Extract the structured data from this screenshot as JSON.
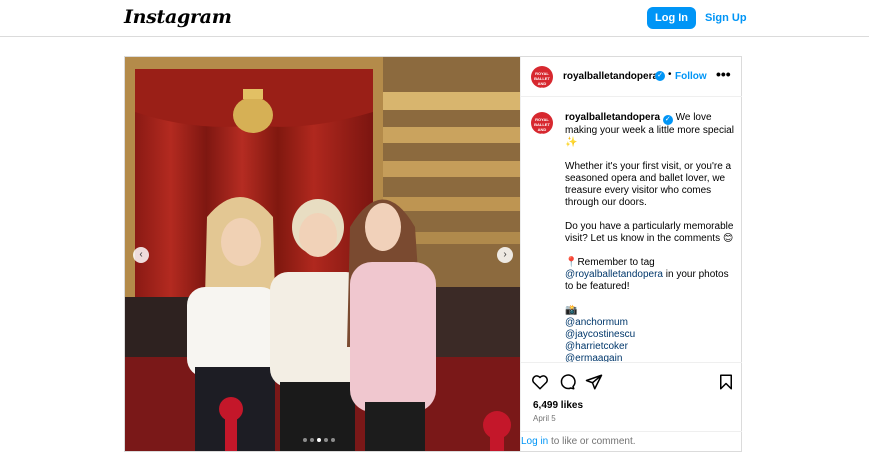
{
  "header": {
    "logo": "Instagram",
    "login_label": "Log In",
    "signup_label": "Sign Up"
  },
  "post": {
    "username": "royalballetandopera",
    "avatar_text": "ROYAL BALLET AND OPERA",
    "follow_label": "Follow",
    "dot_separator": "•",
    "more_label": "•••",
    "caption": {
      "first_line": "We love making your week a little more special ✨",
      "p2": "Whether it's your first visit, or you're a seasoned opera and ballet lover, we treasure every visitor who comes through our doors.",
      "p3": "Do you have a particularly memorable visit? Let us know in the comments 😊",
      "p4_prefix": "📍Remember to tag",
      "p4_mention": "@royalballetandopera",
      "p4_suffix": "in your photos to be featured!",
      "camera": "📸",
      "credits": [
        "@anchormum",
        "@jaycostinescu",
        "@harrietcoker",
        "@ermaagain"
      ]
    },
    "likes": "6,499 likes",
    "date": "April 5",
    "login_link": "Log in",
    "login_suffix": "to like or comment.",
    "carousel": {
      "prev": "‹",
      "next": "›",
      "slide_count": 5,
      "active_index": 2
    }
  },
  "colors": {
    "accent": "#0095f6",
    "brand_red": "#d7282f",
    "mention": "#00376b"
  },
  "icons": [
    "heart-icon",
    "comment-icon",
    "share-icon",
    "bookmark-icon",
    "verified-icon"
  ]
}
